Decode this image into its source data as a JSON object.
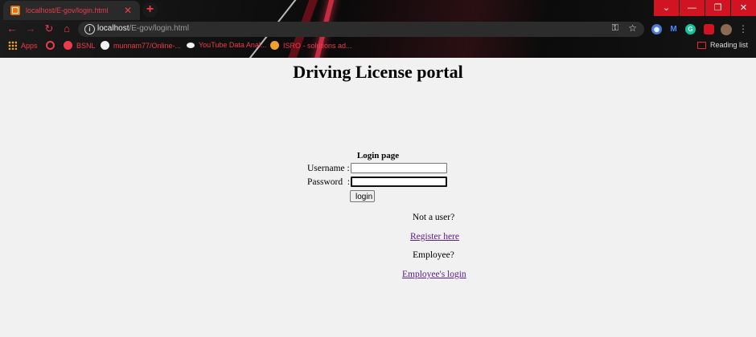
{
  "browser": {
    "tab_title": "localhost/E-gov/login.html",
    "url_host": "localhost",
    "url_path": "/E-gov/login.html",
    "window_controls": [
      "chevron-down-icon",
      "minimize-icon",
      "restore-icon",
      "close-icon"
    ],
    "accent_color": "#ee3b4b"
  },
  "bookmarks": [
    {
      "label": "Apps",
      "icon": "apps-grid-icon"
    },
    {
      "label": "",
      "icon": "red-circle-icon"
    },
    {
      "label": "BSNL",
      "icon": "bsnl-icon"
    },
    {
      "label": "munnam77/Online-...",
      "icon": "github-icon"
    },
    {
      "label": "YouTube Data Anal...",
      "icon": "medium-icon"
    },
    {
      "label": "ISRO - solutions ad...",
      "icon": "isro-icon"
    }
  ],
  "reading_list": "Reading list",
  "page": {
    "heading": "Driving License portal",
    "form": {
      "caption": "Login page",
      "username_label": "Username :",
      "password_label": "Password  :",
      "username_value": "",
      "password_value": "",
      "login_button": "login"
    },
    "not_user_text": "Not a user?",
    "register_link": "Register here",
    "employee_text": "Employee?",
    "employee_link": "Employee's login"
  }
}
